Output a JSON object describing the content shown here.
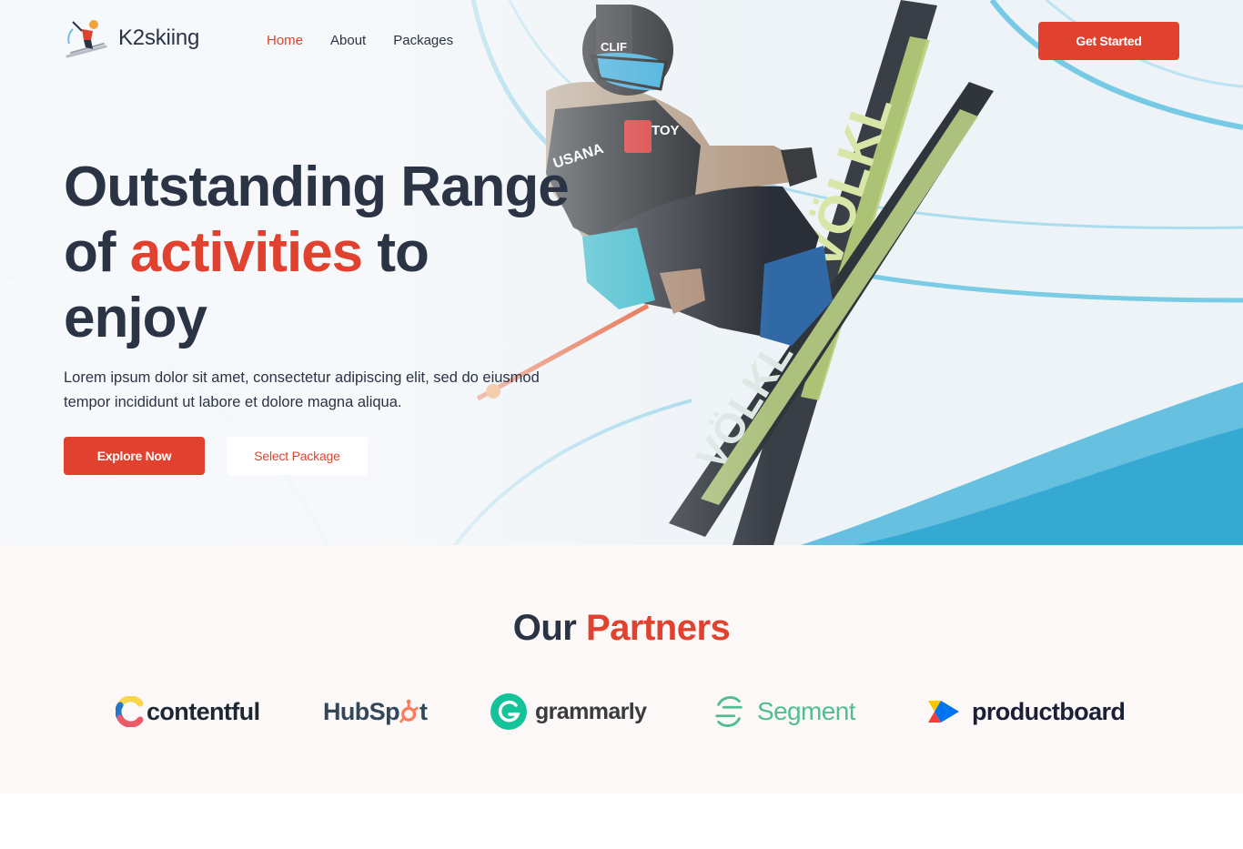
{
  "brand": {
    "name": "K2skiing"
  },
  "nav": {
    "items": [
      {
        "label": "Home"
      },
      {
        "label": "About"
      },
      {
        "label": "Packages"
      }
    ]
  },
  "header": {
    "cta_label": "Get Started"
  },
  "hero": {
    "title_line1": "Outstanding Range",
    "title_line2_prefix": "of ",
    "title_accent": "activities",
    "title_line2_suffix": " to",
    "title_line3": "enjoy",
    "description": "Lorem ipsum dolor sit amet, consectetur adipiscing elit, sed do eiusmod tempor incididunt ut labore et dolore magna aliqua.",
    "primary_button": "Explore Now",
    "secondary_button": "Select Package",
    "image_text": {
      "ski_brand": "VÖLKL",
      "bib_brand": "USANA",
      "helmet_brand": "CLIF",
      "sponsor": "TOY"
    }
  },
  "partners": {
    "title_prefix": "Our ",
    "title_accent": "Partners",
    "logos": [
      {
        "name": "contentful"
      },
      {
        "name_part1": "HubSp",
        "name_part2": "t"
      },
      {
        "name": "grammarly"
      },
      {
        "name": "Segment"
      },
      {
        "name": "productboard"
      }
    ]
  },
  "colors": {
    "accent": "#e0422f",
    "text": "#2b3445",
    "partners_bg": "#fbf8f7"
  }
}
